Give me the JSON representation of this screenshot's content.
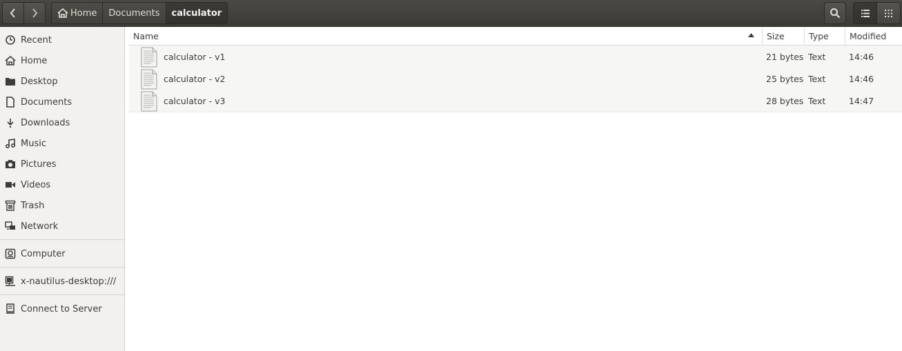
{
  "header": {
    "breadcrumbs": [
      "Home",
      "Documents",
      "calculator"
    ]
  },
  "sidebar": {
    "items": [
      {
        "label": "Recent",
        "icon": "clock-icon"
      },
      {
        "label": "Home",
        "icon": "home-icon"
      },
      {
        "label": "Desktop",
        "icon": "folder-icon"
      },
      {
        "label": "Documents",
        "icon": "document-icon"
      },
      {
        "label": "Downloads",
        "icon": "download-icon"
      },
      {
        "label": "Music",
        "icon": "music-icon"
      },
      {
        "label": "Pictures",
        "icon": "camera-icon"
      },
      {
        "label": "Videos",
        "icon": "video-icon"
      },
      {
        "label": "Trash",
        "icon": "trash-icon"
      },
      {
        "label": "Network",
        "icon": "network-icon"
      },
      {
        "label": "Computer",
        "icon": "drive-icon"
      },
      {
        "label": "x-nautilus-desktop:///",
        "icon": "network-drive-icon"
      },
      {
        "label": "Connect to Server",
        "icon": "server-icon"
      }
    ]
  },
  "table": {
    "columns": [
      "Name",
      "Size",
      "Type",
      "Modified"
    ],
    "rows": [
      {
        "name": "calculator - v1",
        "size": "21 bytes",
        "type": "Text",
        "modified": "14:46"
      },
      {
        "name": "calculator - v2",
        "size": "25 bytes",
        "type": "Text",
        "modified": "14:46"
      },
      {
        "name": "calculator - v3",
        "size": "28 bytes",
        "type": "Text",
        "modified": "14:47"
      }
    ]
  }
}
